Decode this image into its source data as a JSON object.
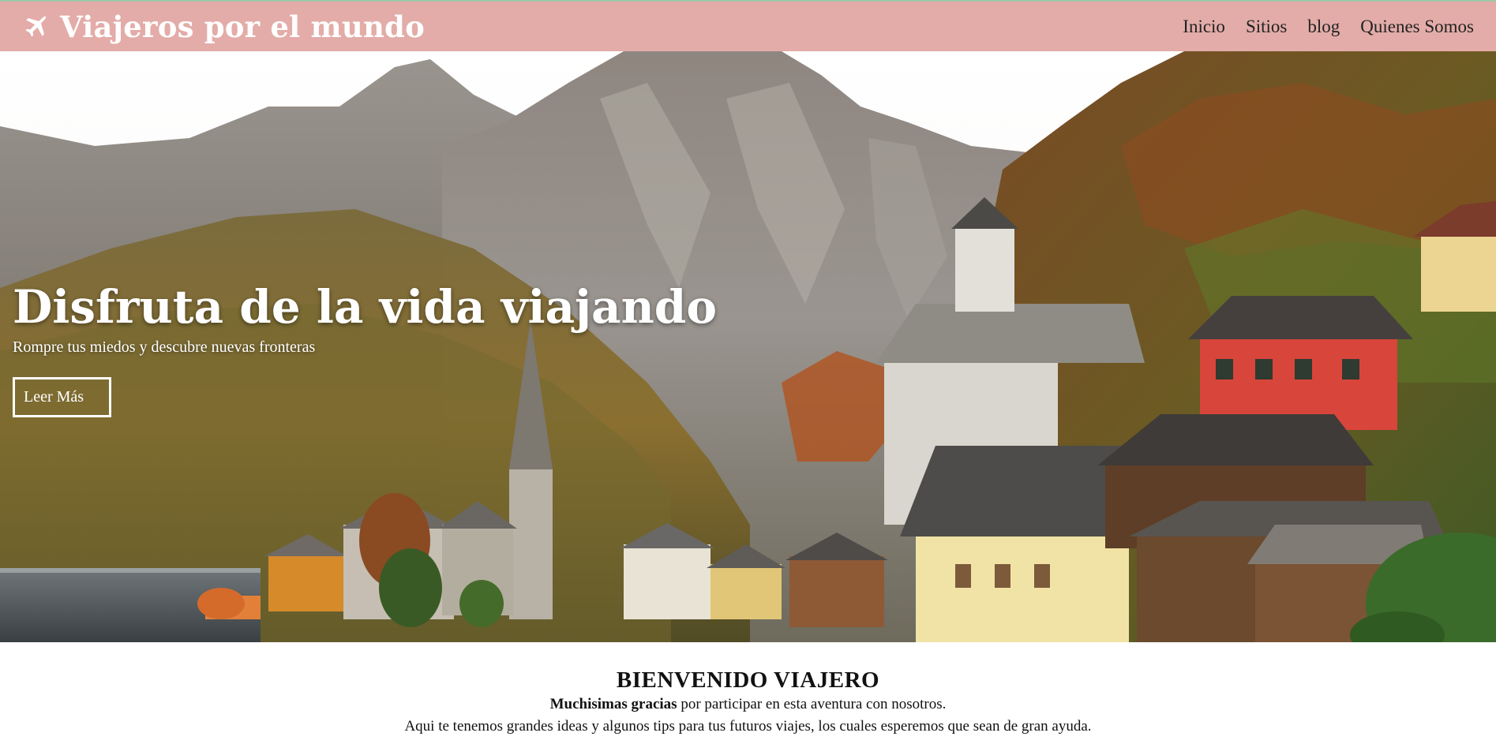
{
  "nav": {
    "brand": "Viajeros por el mundo",
    "brand_icon": "airplane-icon",
    "links": [
      "Inicio",
      "Sitios",
      "blog",
      "Quienes Somos"
    ]
  },
  "hero": {
    "title": "Disfruta de la vida viajando",
    "subtitle": "Rompre tus miedos y descubre nuevas fronteras",
    "button": "Leer Más"
  },
  "welcome": {
    "title": "BIENVENIDO VIAJERO",
    "line1_bold": "Muchisimas gracias",
    "line1_rest": " por participar en esta aventura con nosotros.",
    "line2": "Aqui te tenemos grandes ideas y algunos tips para tus futuros viajes, los cuales esperemos que sean de gran ayuda."
  },
  "colors": {
    "navbar": "#e3aca8",
    "brand_text": "#ffffff",
    "nav_link": "#222222"
  }
}
